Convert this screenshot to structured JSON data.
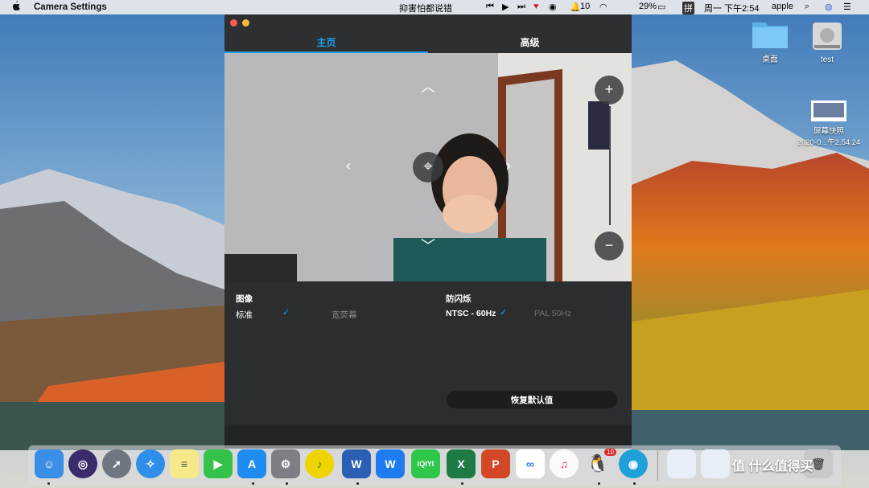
{
  "menubar": {
    "app_name": "Camera Settings",
    "center_text": "抑害怕都说错",
    "notification_count": "10",
    "battery": "29%",
    "input_method": "拼",
    "datetime": "周一 下午2:54",
    "user": "apple"
  },
  "desktop": {
    "icons": [
      {
        "label": "桌面"
      },
      {
        "label": "test"
      },
      {
        "label": "屏幕快照\n2020-0...午2.54.24"
      }
    ]
  },
  "window": {
    "tabs": [
      {
        "label": "主页",
        "active": true
      },
      {
        "label": "高级",
        "active": false
      }
    ],
    "image_section": {
      "title": "图像",
      "options": [
        {
          "label": "标准",
          "selected": true
        },
        {
          "label": "宽荧幕",
          "selected": false
        }
      ]
    },
    "flicker_section": {
      "title": "防闪烁",
      "options": [
        {
          "label": "NTSC - 60Hz",
          "selected": true
        },
        {
          "label": "PAL 50Hz",
          "selected": false
        }
      ]
    },
    "restore_button": "恢复默认值"
  },
  "dock": {
    "apps": [
      {
        "name": "finder-icon"
      },
      {
        "name": "siri-icon"
      },
      {
        "name": "launchpad-icon"
      },
      {
        "name": "safari-icon"
      },
      {
        "name": "notes-icon"
      },
      {
        "name": "facetime-icon"
      },
      {
        "name": "appstore-icon"
      },
      {
        "name": "system-preferences-icon"
      },
      {
        "name": "music-app-icon"
      },
      {
        "name": "word-icon",
        "letter": "W"
      },
      {
        "name": "wps-icon",
        "letter": "W"
      },
      {
        "name": "iqiyi-icon",
        "letter": "iQIYI"
      },
      {
        "name": "excel-icon",
        "letter": "X"
      },
      {
        "name": "powerpoint-icon",
        "letter": "P"
      },
      {
        "name": "baidu-netdisk-icon"
      },
      {
        "name": "itunes-icon"
      },
      {
        "name": "qq-icon",
        "badge": "10"
      },
      {
        "name": "camera-app-icon"
      }
    ]
  },
  "watermark": "值 什么值得买",
  "colors": {
    "accent": "#1aa0e8",
    "window_bg": "#2c2d2f"
  }
}
